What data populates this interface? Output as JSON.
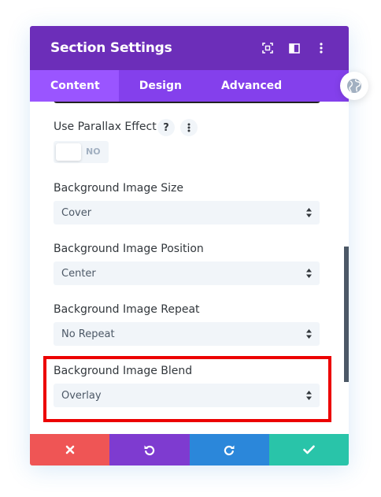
{
  "header": {
    "title": "Section Settings",
    "icons": [
      "fullscreen-icon",
      "split-view-icon",
      "more-options-icon"
    ]
  },
  "tabs": [
    {
      "label": "Content",
      "active": true
    },
    {
      "label": "Design",
      "active": false
    },
    {
      "label": "Advanced",
      "active": false
    }
  ],
  "fields": {
    "parallax": {
      "label": "Use Parallax Effect",
      "help": "?",
      "toggle_text": "NO",
      "enabled": false
    },
    "image_size": {
      "label": "Background Image Size",
      "value": "Cover"
    },
    "image_position": {
      "label": "Background Image Position",
      "value": "Center"
    },
    "image_repeat": {
      "label": "Background Image Repeat",
      "value": "No Repeat"
    },
    "image_blend": {
      "label": "Background Image Blend",
      "value": "Overlay"
    }
  },
  "footer": {
    "buttons": [
      {
        "name": "discard",
        "icon": "close-icon",
        "color": "#ef5555"
      },
      {
        "name": "undo",
        "icon": "undo-icon",
        "color": "#7e3bd0"
      },
      {
        "name": "redo",
        "icon": "redo-icon",
        "color": "#2b87da"
      },
      {
        "name": "save",
        "icon": "checkmark-icon",
        "color": "#29c4a9"
      }
    ]
  },
  "colors": {
    "header_bg": "#6c2eb9",
    "tabs_bg": "#8440ec",
    "active_tab_bg": "#9a55ff",
    "highlight_border": "#ec0000"
  },
  "floating": {
    "icon": "globe-icon"
  }
}
